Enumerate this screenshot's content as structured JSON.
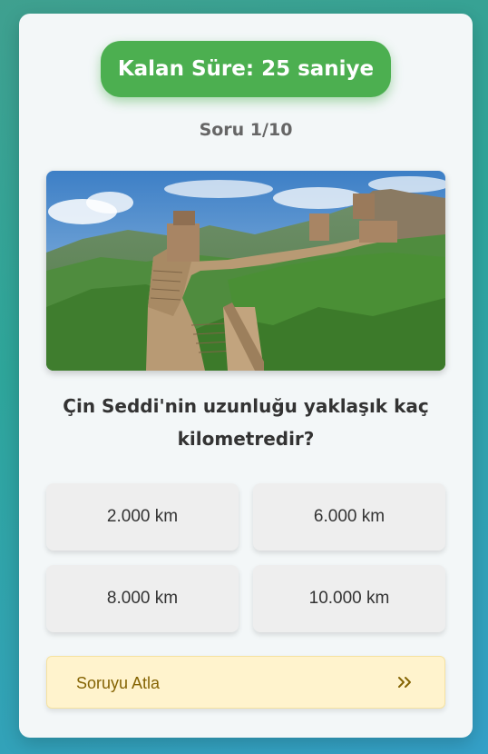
{
  "timer": {
    "label": "Kalan Süre:",
    "seconds": "25",
    "unit": "saniye"
  },
  "quiz": {
    "counter": "Soru 1/10",
    "image": {
      "subject": "great-wall-of-china"
    },
    "question": "Çin Seddi'nin uzunluğu yaklaşık kaç kilometredir?",
    "answers": [
      {
        "label": "2.000 km"
      },
      {
        "label": "6.000 km"
      },
      {
        "label": "8.000 km"
      },
      {
        "label": "10.000 km"
      }
    ],
    "skip": {
      "label": "Soruyu Atla",
      "icon": "double-chevron-right-icon"
    }
  },
  "colors": {
    "timer_bg": "#4caf50",
    "card_bg": "#f3f7f8",
    "answer_bg": "#eeeeee",
    "skip_bg": "#fff3cd",
    "skip_text": "#856404"
  }
}
